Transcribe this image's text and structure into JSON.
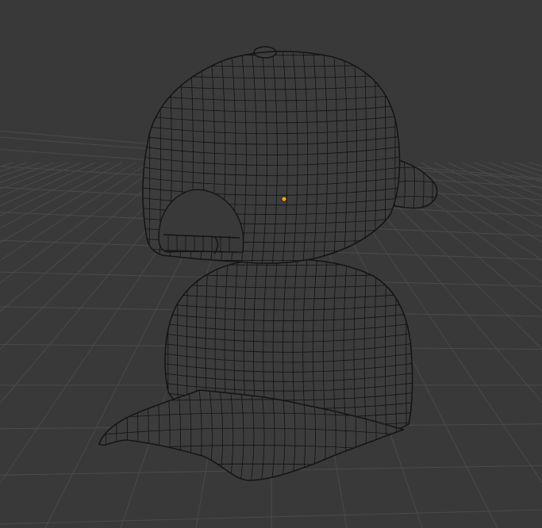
{
  "viewport": {
    "background": "#393939",
    "grid_color": "#4a4a4a",
    "wire_color": "#101010",
    "origin_color": "#f5a623",
    "mode": "wireframe"
  },
  "objects": [
    {
      "name": "cap-back-view",
      "kind": "mesh"
    },
    {
      "name": "cap-front-view",
      "kind": "mesh"
    }
  ]
}
